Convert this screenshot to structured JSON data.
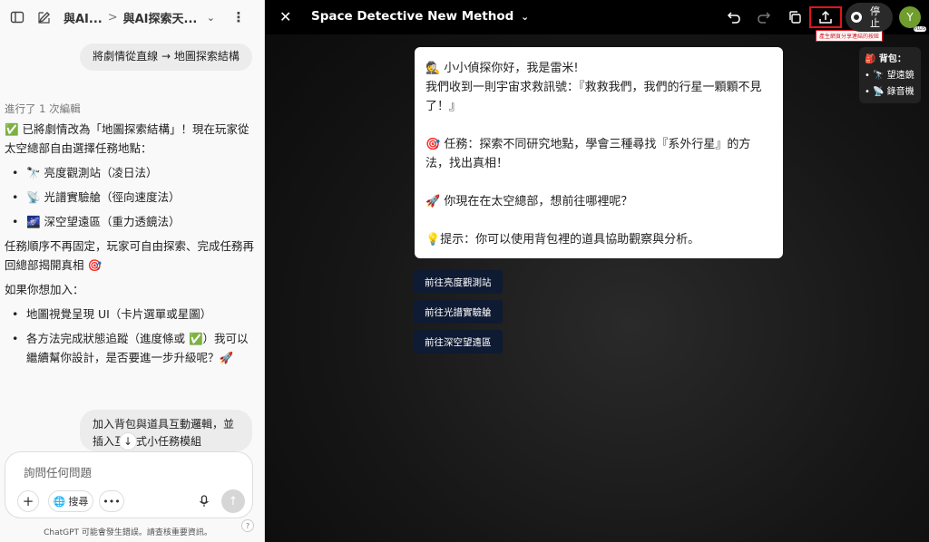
{
  "sidebar_header": {
    "crumb1": "與AI...",
    "sep": ">",
    "crumb2": "與AI探索天..."
  },
  "chat": {
    "user_message_1": "將劇情從直線 → 地圖探索結構",
    "edited_note": "進行了 1 次編輯",
    "assistant": {
      "intro": "✅ 已將劇情改為「地圖探索結構」！現在玩家從太空總部自由選擇任務地點：",
      "locations": [
        "🔭 亮度觀測站（凌日法）",
        "📡 光譜實驗艙（徑向速度法）",
        "🌌 深空望遠區（重力透鏡法）"
      ],
      "order_note": "任務順序不再固定，玩家可自由探索、完成任務再回總部揭開真相 🎯",
      "addon_intro": "如果你想加入：",
      "addons": [
        "地圖視覺呈現 UI（卡片選單或星圖）",
        "各方法完成狀態追蹤（進度條或 ✅）我可以繼續幫你設計，是否要進一步升級呢？🚀"
      ]
    },
    "user_message_2": "加入背包與道具互動邏輯，並插入互動式小任務模組"
  },
  "composer": {
    "placeholder": "詢問任何問題",
    "search_label": "搜尋",
    "disclaimer": "ChatGPT 可能會發生錯誤。請查核重要資訊。",
    "help": "?"
  },
  "canvas_header": {
    "title": "Space Detective New Method",
    "share_tooltip": "產生網頁分享連結的按鈕",
    "stop_label": "停止",
    "avatar_letter": "Y",
    "avatar_badge": "PLUS"
  },
  "game": {
    "card_lines": [
      "🕵️ 小小偵探你好，我是雷米!",
      "我們收到一則宇宙求救訊號：『救救我們，我們的行星一顆顆不見了！』",
      "",
      "🎯 任務：探索不同研究地點，學會三種尋找『系外行星』的方法，找出真相！",
      "",
      "🚀 你現在在太空總部，想前往哪裡呢？",
      "",
      "💡提示：你可以使用背包裡的道具協助觀察與分析。"
    ],
    "choices": [
      "前往亮度觀測站",
      "前往光譜實驗艙",
      "前往深空望遠區"
    ],
    "bag": {
      "title": "🎒 背包：",
      "items": [
        "🔭 望遠鏡",
        "📡 錄音機"
      ]
    }
  },
  "colors": {
    "share_highlight": "#e0141e",
    "choice_button": "#0f1a33",
    "avatar": "#6f9d2e"
  }
}
